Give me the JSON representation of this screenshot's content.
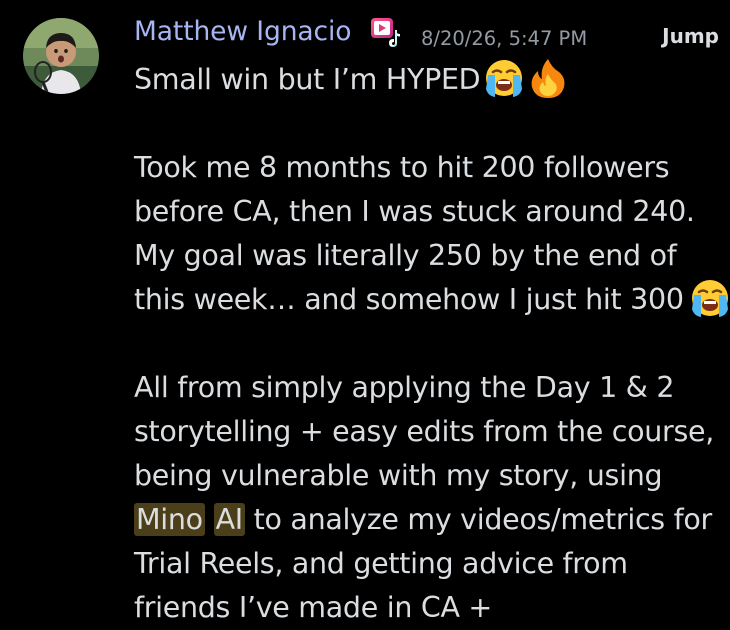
{
  "message": {
    "author": "Matthew Ignacio",
    "timestamp": "8/20/26, 5:47 PM",
    "jump_label": "Jump",
    "lines": {
      "l1": "Small win but I’m HYPED",
      "l3": "Took me 8 months to hit 200 followers",
      "l4": "before CA, then I was stuck around 240.",
      "l5": "My goal was literally 250 by the end of",
      "l6": "this week… and somehow I just hit 300",
      "l8": "All from simply applying the Day 1 & 2",
      "l9": "storytelling + easy edits from the course,",
      "l10": "being vulnerable with my story, using",
      "l11_link1": "Mino",
      "l11_link2": "AI",
      "l11_rest": " to analyze my videos/metrics for",
      "l12": "Trial Reels, and getting advice from",
      "l13": "friends I’ve made in CA +"
    },
    "emojis": [
      "loudly-crying-face",
      "fire",
      "loudly-crying-face"
    ],
    "colors": {
      "background": "#000000",
      "author": "#a7b6f2",
      "text": "#dbdee1",
      "timestamp": "#949ba4",
      "highlight": "#4b3f1a"
    }
  }
}
